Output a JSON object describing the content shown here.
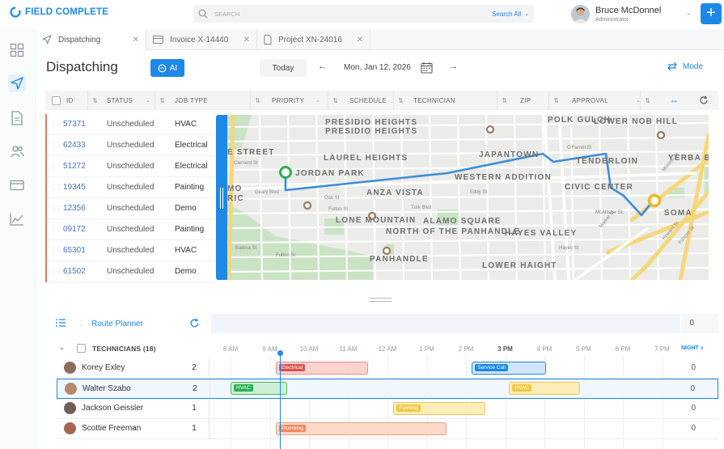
{
  "app": {
    "logo_text": "FIELD COMPLETE",
    "search_placeholder": "SEARCH",
    "search_scope": "Search All",
    "user_name": "Bruce McDonnel",
    "user_role": "Administrator",
    "add_label": "+"
  },
  "tabs": [
    {
      "label": "Dispatching",
      "icon": "send-icon"
    },
    {
      "label": "Invoice X-14440",
      "icon": "card-icon"
    },
    {
      "label": "Project XN-24016",
      "icon": "document-icon"
    }
  ],
  "toolbar": {
    "title": "Dispatching",
    "ai_label": "AI",
    "today_label": "Today",
    "date": "Mon, Jan 12, 2026",
    "mode_label": "Mode"
  },
  "grid": {
    "columns": [
      "ID",
      "STATUS",
      "JOB TYPE",
      "PRIORITY",
      "SCHEDULE",
      "TECHNICIAN",
      "ZIP",
      "APPROVAL"
    ],
    "rows": [
      {
        "id": "57371",
        "status": "Unscheduled",
        "type": "HVAC"
      },
      {
        "id": "62433",
        "status": "Unscheduled",
        "type": "Electrical"
      },
      {
        "id": "51272",
        "status": "Unscheduled",
        "type": "Electrical"
      },
      {
        "id": "19345",
        "status": "Unscheduled",
        "type": "Painting"
      },
      {
        "id": "12356",
        "status": "Unscheduled",
        "type": "Demo"
      },
      {
        "id": "09172",
        "status": "Unscheduled",
        "type": "Painting"
      },
      {
        "id": "65301",
        "status": "Unscheduled",
        "type": "HVAC"
      },
      {
        "id": "61502",
        "status": "Unscheduled",
        "type": "Demo"
      }
    ]
  },
  "map": {
    "labels": {
      "presidio_heights": "PRESIDIO HEIGHTS",
      "polk_gulch": "POLK GULCH",
      "lower_nob_hill": "LOWER NOB HILL",
      "e_street": "E STREET",
      "laurel_heights": "LAUREL HEIGHTS",
      "japantown": "JAPANTOWN",
      "jordan_park": "JORDAN PARK",
      "western_addition": "WESTERN ADDITION",
      "tenderloin": "TENDERLOIN",
      "yerba": "YERBA B",
      "civic_center": "CIVIC CENTER",
      "anza_vista": "ANZA VISTA",
      "mo": "MO",
      "ric": "RIC",
      "lone_mountain": "LONE MOUNTAIN",
      "alamo_square": "ALAMO SQUARE",
      "north_panhandle": "NORTH OF THE PANHANDLE",
      "hayes_valley": "HAYES VALLEY",
      "soma": "SOMA",
      "panhandle": "PANHANDLE",
      "lower_haight": "LOWER HAIGHT",
      "geary_blvd": "Geary Blvd",
      "ofarrell": "O'Farrell St",
      "eddy": "Eddy St",
      "turk": "Turk Blvd",
      "fulton": "Fulton St",
      "balboa": "Balboa St",
      "clement": "Clement St",
      "mcallister": "McAllister St",
      "mission": "Mission St",
      "howard": "Howard St",
      "folsom": "Folsom St",
      "gough": "Gough St",
      "franklin": "Franklin St",
      "market": "Market St",
      "hayes": "Hayes St",
      "page": "Page St",
      "haight": "Haight St",
      "oak": "Oak St"
    }
  },
  "scheduler": {
    "route_planner_label": "Route Planner",
    "route_total": "0",
    "technicians_label": "TECHNICIANS (18)",
    "night_label": "NIGHT »",
    "hours": [
      "8 AM",
      "9 AM",
      "10 AM",
      "11 AM",
      "12 AM",
      "1 PM",
      "2 PM",
      "3 PM",
      "4 PM",
      "5 PM",
      "6 PM",
      "7 PM"
    ],
    "current_hour_index": 7,
    "technicians": [
      {
        "name": "Korey Exley",
        "count": "2",
        "total": "0",
        "avatar_color": "#8a6d5a"
      },
      {
        "name": "Walter Szabo",
        "count": "2",
        "total": "0",
        "avatar_color": "#b58c6a"
      },
      {
        "name": "Jackson Geissler",
        "count": "1",
        "total": "0",
        "avatar_color": "#6d5f57"
      },
      {
        "name": "Scottie Freeman",
        "count": "1",
        "total": "0",
        "avatar_color": "#a6674e"
      }
    ],
    "jobs": [
      {
        "row": 0,
        "label": "Electrical",
        "color": "red",
        "start": 9.15,
        "end": 11.5
      },
      {
        "row": 0,
        "label": "Service Call",
        "color": "blue",
        "start": 14.15,
        "end": 16.05
      },
      {
        "row": 1,
        "label": "HVAC",
        "color": "green",
        "start": 8.0,
        "end": 9.45
      },
      {
        "row": 1,
        "label": "HVAC",
        "color": "yellow",
        "start": 15.1,
        "end": 16.9
      },
      {
        "row": 2,
        "label": "Painting",
        "color": "yellow",
        "start": 12.15,
        "end": 14.5
      },
      {
        "row": 3,
        "label": "Plumbing",
        "color": "orange",
        "start": 9.15,
        "end": 13.5
      }
    ]
  }
}
